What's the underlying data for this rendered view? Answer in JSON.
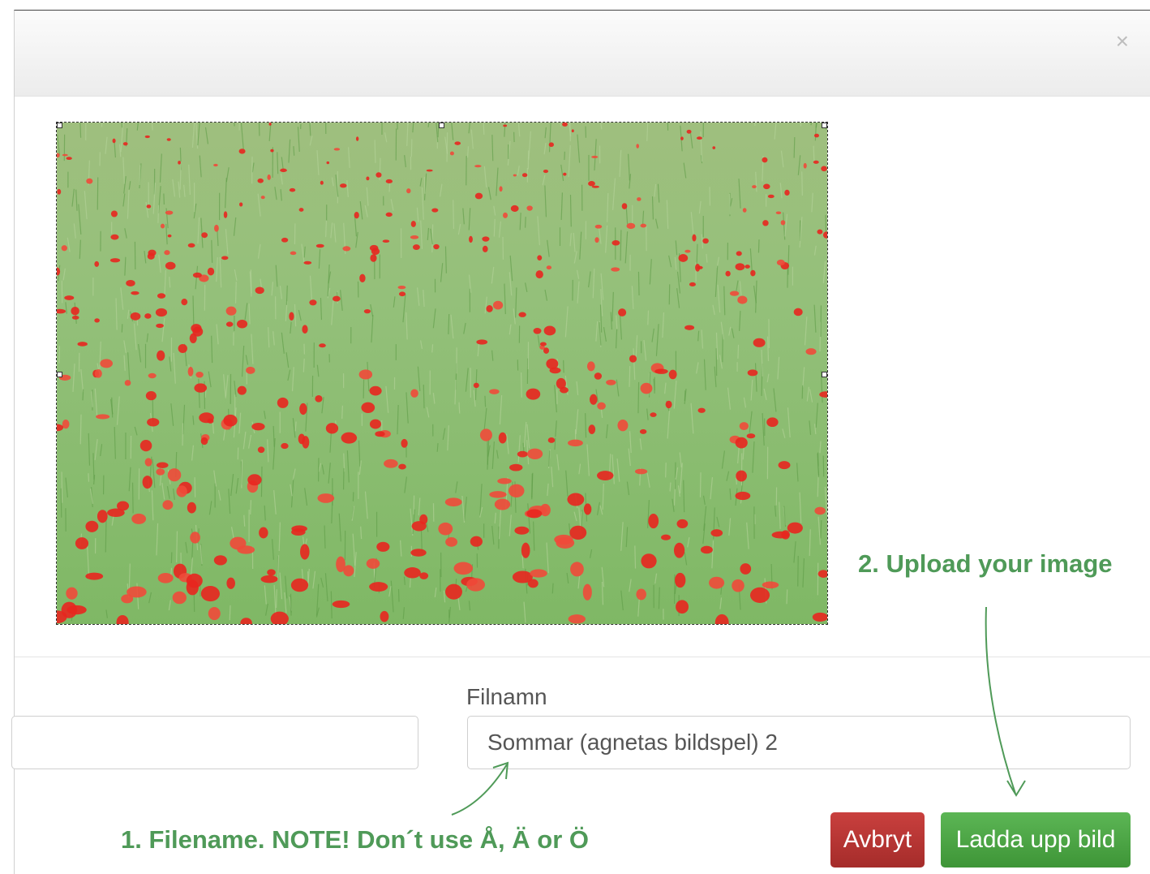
{
  "dialog": {
    "close_label": "×",
    "close_icon": "close-icon"
  },
  "preview": {
    "image_description_icon": "poppy-field-image"
  },
  "form": {
    "left_field_value": "",
    "filename_label": "Filnamn",
    "filename_value": "Sommar (agnetas bildspel) 2"
  },
  "buttons": {
    "cancel_label": "Avbryt",
    "upload_label": "Ladda upp bild"
  },
  "annotations": {
    "note_filename": "1. Filename. NOTE! Don´t use Å, Ä or Ö",
    "note_upload": "2. Upload your image"
  },
  "colors": {
    "cancel": "#b3332f",
    "upload": "#4ca546",
    "annotation": "#4f9a58"
  }
}
